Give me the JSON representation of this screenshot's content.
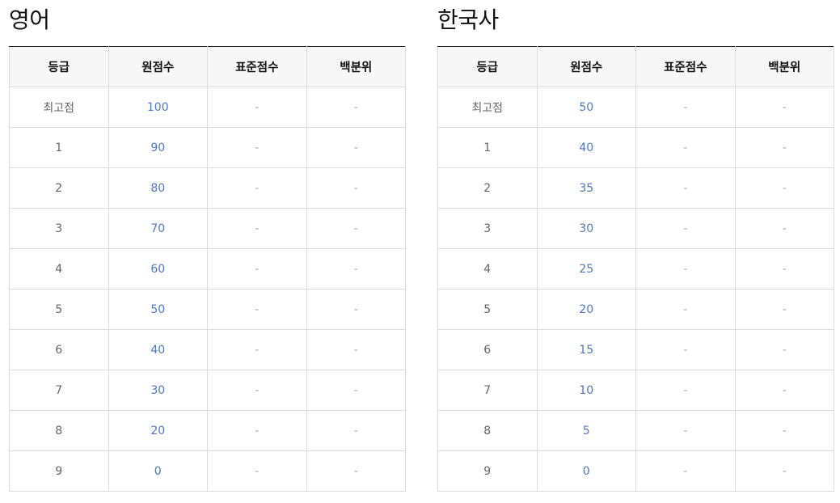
{
  "panels": [
    {
      "title": "영어",
      "headers": [
        "등급",
        "원점수",
        "표준점수",
        "백분위"
      ],
      "rows": [
        {
          "grade": "최고점",
          "raw": "100",
          "std": "-",
          "pct": "-"
        },
        {
          "grade": "1",
          "raw": "90",
          "std": "-",
          "pct": "-"
        },
        {
          "grade": "2",
          "raw": "80",
          "std": "-",
          "pct": "-"
        },
        {
          "grade": "3",
          "raw": "70",
          "std": "-",
          "pct": "-"
        },
        {
          "grade": "4",
          "raw": "60",
          "std": "-",
          "pct": "-"
        },
        {
          "grade": "5",
          "raw": "50",
          "std": "-",
          "pct": "-"
        },
        {
          "grade": "6",
          "raw": "40",
          "std": "-",
          "pct": "-"
        },
        {
          "grade": "7",
          "raw": "30",
          "std": "-",
          "pct": "-"
        },
        {
          "grade": "8",
          "raw": "20",
          "std": "-",
          "pct": "-"
        },
        {
          "grade": "9",
          "raw": "0",
          "std": "-",
          "pct": "-"
        }
      ]
    },
    {
      "title": "한국사",
      "headers": [
        "등급",
        "원점수",
        "표준점수",
        "백분위"
      ],
      "rows": [
        {
          "grade": "최고점",
          "raw": "50",
          "std": "-",
          "pct": "-"
        },
        {
          "grade": "1",
          "raw": "40",
          "std": "-",
          "pct": "-"
        },
        {
          "grade": "2",
          "raw": "35",
          "std": "-",
          "pct": "-"
        },
        {
          "grade": "3",
          "raw": "30",
          "std": "-",
          "pct": "-"
        },
        {
          "grade": "4",
          "raw": "25",
          "std": "-",
          "pct": "-"
        },
        {
          "grade": "5",
          "raw": "20",
          "std": "-",
          "pct": "-"
        },
        {
          "grade": "6",
          "raw": "15",
          "std": "-",
          "pct": "-"
        },
        {
          "grade": "7",
          "raw": "10",
          "std": "-",
          "pct": "-"
        },
        {
          "grade": "8",
          "raw": "5",
          "std": "-",
          "pct": "-"
        },
        {
          "grade": "9",
          "raw": "0",
          "std": "-",
          "pct": "-"
        }
      ]
    }
  ],
  "colors": {
    "raw_value": "#4f76c1",
    "header_bg": "#f7f7f7",
    "border": "#dddddd",
    "top_rule": "#222222"
  }
}
